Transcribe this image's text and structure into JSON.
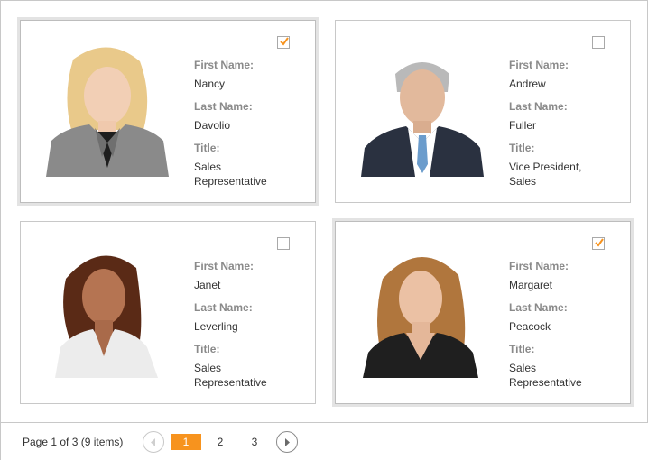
{
  "accent_color": "#f7931e",
  "labels": {
    "first_name": "First Name:",
    "last_name": "Last Name:",
    "title": "Title:"
  },
  "employees": [
    {
      "first_name": "Nancy",
      "last_name": "Davolio",
      "title_line1": "Sales",
      "title_line2": "Representative",
      "selected": true
    },
    {
      "first_name": "Andrew",
      "last_name": "Fuller",
      "title_line1": "Vice President,",
      "title_line2": "Sales",
      "selected": false
    },
    {
      "first_name": "Janet",
      "last_name": "Leverling",
      "title_line1": "Sales",
      "title_line2": "Representative",
      "selected": false
    },
    {
      "first_name": "Margaret",
      "last_name": "Peacock",
      "title_line1": "Sales",
      "title_line2": "Representative",
      "selected": true
    }
  ],
  "pager": {
    "info": "Page 1 of 3 (9 items)",
    "pages": [
      "1",
      "2",
      "3"
    ],
    "current_page": "1",
    "prev_icon": "chevron-left-icon",
    "next_icon": "chevron-right-icon"
  }
}
